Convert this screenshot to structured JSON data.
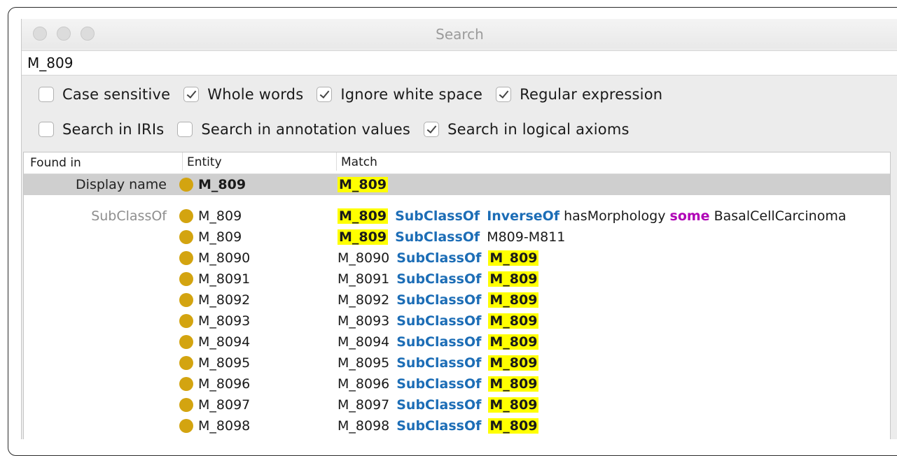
{
  "window": {
    "title": "Search"
  },
  "search": {
    "value": "M_809"
  },
  "options": {
    "row1": [
      {
        "label": "Case sensitive",
        "checked": false
      },
      {
        "label": "Whole words",
        "checked": true
      },
      {
        "label": "Ignore white space",
        "checked": true
      },
      {
        "label": "Regular expression",
        "checked": true
      }
    ],
    "row2": [
      {
        "label": "Search in IRIs",
        "checked": false
      },
      {
        "label": "Search in annotation values",
        "checked": false
      },
      {
        "label": "Search in logical axioms",
        "checked": true
      }
    ]
  },
  "columns": {
    "found_in": "Found in",
    "entity": "Entity",
    "match": "Match"
  },
  "rows": [
    {
      "found_in": "Display name",
      "entity": "M_809",
      "selected": true,
      "match": {
        "highlight": "M_809"
      }
    },
    {
      "found_in": "SubClassOf",
      "entity": "M_809",
      "match": {
        "lead_highlight": "M_809",
        "kw1": "SubClassOf",
        "kw2": "InverseOf",
        "p1": "hasMorphology",
        "kw3": "some",
        "p2": "BasalCellCarcinoma"
      }
    },
    {
      "entity": "M_809",
      "match": {
        "lead_highlight": "M_809",
        "kw1": "SubClassOf",
        "p1": "M809-M811"
      }
    },
    {
      "entity": "M_8090",
      "match": {
        "lead": "M_8090",
        "kw1": "SubClassOf",
        "tail_highlight": "M_809"
      }
    },
    {
      "entity": "M_8091",
      "match": {
        "lead": "M_8091",
        "kw1": "SubClassOf",
        "tail_highlight": "M_809"
      }
    },
    {
      "entity": "M_8092",
      "match": {
        "lead": "M_8092",
        "kw1": "SubClassOf",
        "tail_highlight": "M_809"
      }
    },
    {
      "entity": "M_8093",
      "match": {
        "lead": "M_8093",
        "kw1": "SubClassOf",
        "tail_highlight": "M_809"
      }
    },
    {
      "entity": "M_8094",
      "match": {
        "lead": "M_8094",
        "kw1": "SubClassOf",
        "tail_highlight": "M_809"
      }
    },
    {
      "entity": "M_8095",
      "match": {
        "lead": "M_8095",
        "kw1": "SubClassOf",
        "tail_highlight": "M_809"
      }
    },
    {
      "entity": "M_8096",
      "match": {
        "lead": "M_8096",
        "kw1": "SubClassOf",
        "tail_highlight": "M_809"
      }
    },
    {
      "entity": "M_8097",
      "match": {
        "lead": "M_8097",
        "kw1": "SubClassOf",
        "tail_highlight": "M_809"
      }
    },
    {
      "entity": "M_8098",
      "match": {
        "lead": "M_8098",
        "kw1": "SubClassOf",
        "tail_highlight": "M_809"
      }
    }
  ],
  "colors": {
    "highlight": "#ffff00",
    "keyword_blue": "#1c6db6",
    "keyword_purple": "#b000b6",
    "entity_dot": "#d3a410",
    "selected_row": "#cfcfcf"
  },
  "icons": {
    "entity": "class-circle-icon",
    "traffic_lights": "window-control-icon"
  }
}
